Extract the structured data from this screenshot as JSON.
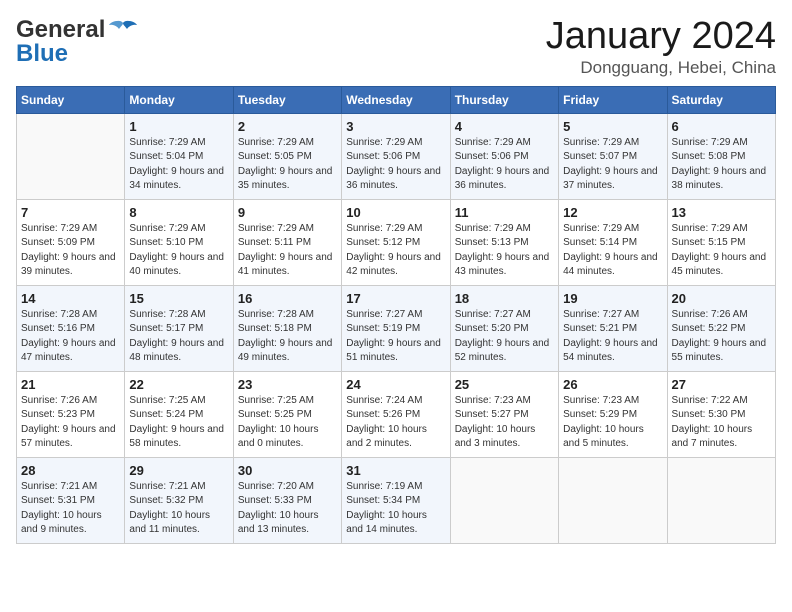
{
  "header": {
    "logo_general": "General",
    "logo_blue": "Blue",
    "month_title": "January 2024",
    "location": "Dongguang, Hebei, China"
  },
  "days_of_week": [
    "Sunday",
    "Monday",
    "Tuesday",
    "Wednesday",
    "Thursday",
    "Friday",
    "Saturday"
  ],
  "weeks": [
    [
      {
        "day": "",
        "sunrise": "",
        "sunset": "",
        "daylight": ""
      },
      {
        "day": "1",
        "sunrise": "Sunrise: 7:29 AM",
        "sunset": "Sunset: 5:04 PM",
        "daylight": "Daylight: 9 hours and 34 minutes."
      },
      {
        "day": "2",
        "sunrise": "Sunrise: 7:29 AM",
        "sunset": "Sunset: 5:05 PM",
        "daylight": "Daylight: 9 hours and 35 minutes."
      },
      {
        "day": "3",
        "sunrise": "Sunrise: 7:29 AM",
        "sunset": "Sunset: 5:06 PM",
        "daylight": "Daylight: 9 hours and 36 minutes."
      },
      {
        "day": "4",
        "sunrise": "Sunrise: 7:29 AM",
        "sunset": "Sunset: 5:06 PM",
        "daylight": "Daylight: 9 hours and 36 minutes."
      },
      {
        "day": "5",
        "sunrise": "Sunrise: 7:29 AM",
        "sunset": "Sunset: 5:07 PM",
        "daylight": "Daylight: 9 hours and 37 minutes."
      },
      {
        "day": "6",
        "sunrise": "Sunrise: 7:29 AM",
        "sunset": "Sunset: 5:08 PM",
        "daylight": "Daylight: 9 hours and 38 minutes."
      }
    ],
    [
      {
        "day": "7",
        "sunrise": "Sunrise: 7:29 AM",
        "sunset": "Sunset: 5:09 PM",
        "daylight": "Daylight: 9 hours and 39 minutes."
      },
      {
        "day": "8",
        "sunrise": "Sunrise: 7:29 AM",
        "sunset": "Sunset: 5:10 PM",
        "daylight": "Daylight: 9 hours and 40 minutes."
      },
      {
        "day": "9",
        "sunrise": "Sunrise: 7:29 AM",
        "sunset": "Sunset: 5:11 PM",
        "daylight": "Daylight: 9 hours and 41 minutes."
      },
      {
        "day": "10",
        "sunrise": "Sunrise: 7:29 AM",
        "sunset": "Sunset: 5:12 PM",
        "daylight": "Daylight: 9 hours and 42 minutes."
      },
      {
        "day": "11",
        "sunrise": "Sunrise: 7:29 AM",
        "sunset": "Sunset: 5:13 PM",
        "daylight": "Daylight: 9 hours and 43 minutes."
      },
      {
        "day": "12",
        "sunrise": "Sunrise: 7:29 AM",
        "sunset": "Sunset: 5:14 PM",
        "daylight": "Daylight: 9 hours and 44 minutes."
      },
      {
        "day": "13",
        "sunrise": "Sunrise: 7:29 AM",
        "sunset": "Sunset: 5:15 PM",
        "daylight": "Daylight: 9 hours and 45 minutes."
      }
    ],
    [
      {
        "day": "14",
        "sunrise": "Sunrise: 7:28 AM",
        "sunset": "Sunset: 5:16 PM",
        "daylight": "Daylight: 9 hours and 47 minutes."
      },
      {
        "day": "15",
        "sunrise": "Sunrise: 7:28 AM",
        "sunset": "Sunset: 5:17 PM",
        "daylight": "Daylight: 9 hours and 48 minutes."
      },
      {
        "day": "16",
        "sunrise": "Sunrise: 7:28 AM",
        "sunset": "Sunset: 5:18 PM",
        "daylight": "Daylight: 9 hours and 49 minutes."
      },
      {
        "day": "17",
        "sunrise": "Sunrise: 7:27 AM",
        "sunset": "Sunset: 5:19 PM",
        "daylight": "Daylight: 9 hours and 51 minutes."
      },
      {
        "day": "18",
        "sunrise": "Sunrise: 7:27 AM",
        "sunset": "Sunset: 5:20 PM",
        "daylight": "Daylight: 9 hours and 52 minutes."
      },
      {
        "day": "19",
        "sunrise": "Sunrise: 7:27 AM",
        "sunset": "Sunset: 5:21 PM",
        "daylight": "Daylight: 9 hours and 54 minutes."
      },
      {
        "day": "20",
        "sunrise": "Sunrise: 7:26 AM",
        "sunset": "Sunset: 5:22 PM",
        "daylight": "Daylight: 9 hours and 55 minutes."
      }
    ],
    [
      {
        "day": "21",
        "sunrise": "Sunrise: 7:26 AM",
        "sunset": "Sunset: 5:23 PM",
        "daylight": "Daylight: 9 hours and 57 minutes."
      },
      {
        "day": "22",
        "sunrise": "Sunrise: 7:25 AM",
        "sunset": "Sunset: 5:24 PM",
        "daylight": "Daylight: 9 hours and 58 minutes."
      },
      {
        "day": "23",
        "sunrise": "Sunrise: 7:25 AM",
        "sunset": "Sunset: 5:25 PM",
        "daylight": "Daylight: 10 hours and 0 minutes."
      },
      {
        "day": "24",
        "sunrise": "Sunrise: 7:24 AM",
        "sunset": "Sunset: 5:26 PM",
        "daylight": "Daylight: 10 hours and 2 minutes."
      },
      {
        "day": "25",
        "sunrise": "Sunrise: 7:23 AM",
        "sunset": "Sunset: 5:27 PM",
        "daylight": "Daylight: 10 hours and 3 minutes."
      },
      {
        "day": "26",
        "sunrise": "Sunrise: 7:23 AM",
        "sunset": "Sunset: 5:29 PM",
        "daylight": "Daylight: 10 hours and 5 minutes."
      },
      {
        "day": "27",
        "sunrise": "Sunrise: 7:22 AM",
        "sunset": "Sunset: 5:30 PM",
        "daylight": "Daylight: 10 hours and 7 minutes."
      }
    ],
    [
      {
        "day": "28",
        "sunrise": "Sunrise: 7:21 AM",
        "sunset": "Sunset: 5:31 PM",
        "daylight": "Daylight: 10 hours and 9 minutes."
      },
      {
        "day": "29",
        "sunrise": "Sunrise: 7:21 AM",
        "sunset": "Sunset: 5:32 PM",
        "daylight": "Daylight: 10 hours and 11 minutes."
      },
      {
        "day": "30",
        "sunrise": "Sunrise: 7:20 AM",
        "sunset": "Sunset: 5:33 PM",
        "daylight": "Daylight: 10 hours and 13 minutes."
      },
      {
        "day": "31",
        "sunrise": "Sunrise: 7:19 AM",
        "sunset": "Sunset: 5:34 PM",
        "daylight": "Daylight: 10 hours and 14 minutes."
      },
      {
        "day": "",
        "sunrise": "",
        "sunset": "",
        "daylight": ""
      },
      {
        "day": "",
        "sunrise": "",
        "sunset": "",
        "daylight": ""
      },
      {
        "day": "",
        "sunrise": "",
        "sunset": "",
        "daylight": ""
      }
    ]
  ]
}
